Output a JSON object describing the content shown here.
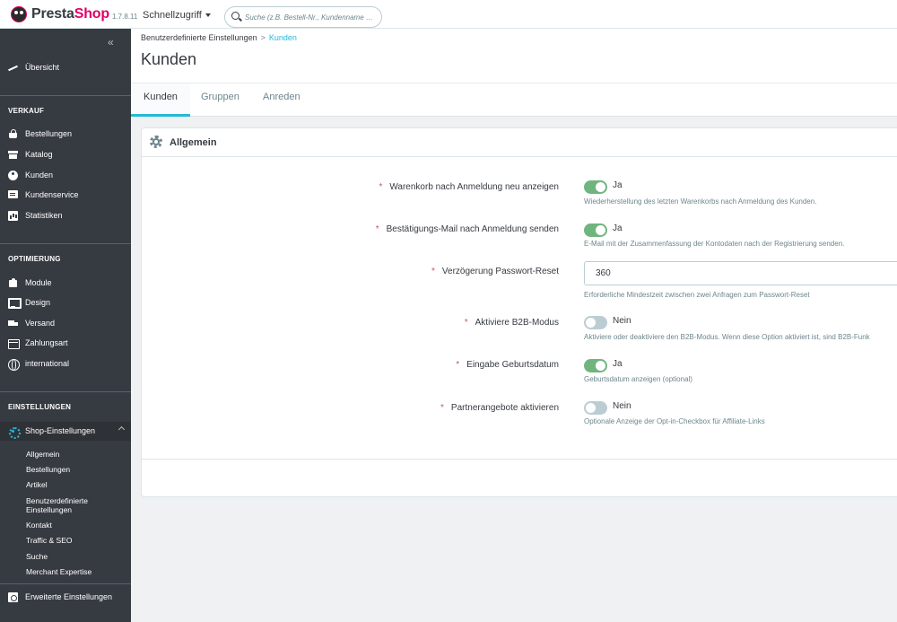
{
  "header": {
    "logo_text_presta": "Presta",
    "logo_text_shop": "Shop",
    "version": "1.7.8.11",
    "quick_access": "Schnellzugriff",
    "search_placeholder": "Suche (z.B. Bestell-Nr., Kundenname …"
  },
  "sidebar": {
    "collapse_icon": "«",
    "overview": "Übersicht",
    "sections": [
      {
        "title": "VERKAUF",
        "items": [
          "Bestellungen",
          "Katalog",
          "Kunden",
          "Kundenservice",
          "Statistiken"
        ]
      },
      {
        "title": "OPTIMIERUNG",
        "items": [
          "Module",
          "Design",
          "Versand",
          "Zahlungsart",
          "international"
        ]
      },
      {
        "title": "EINSTELLUNGEN",
        "items": [
          "Shop-Einstellungen"
        ]
      }
    ],
    "sub_items": [
      "Allgemein",
      "Bestellungen",
      "Artikel",
      "Benutzerdefinierte Einstellungen",
      "Kontakt",
      "Traffic & SEO",
      "Suche",
      "Merchant Expertise"
    ],
    "advanced": "Erweiterte Einstellungen"
  },
  "breadcrumb": {
    "parent": "Benutzerdefinierte Einstellungen",
    "separator": ">",
    "current": "Kunden"
  },
  "page_title": "Kunden",
  "tabs": [
    "Kunden",
    "Gruppen",
    "Anreden"
  ],
  "panel": {
    "title": "Allgemein",
    "rows": [
      {
        "label": "Warenkorb nach Anmeldung neu anzeigen",
        "state": "Ja",
        "on": true,
        "help": "Wiederherstellung des letzten Warenkorbs nach Anmeldung des Kunden."
      },
      {
        "label": "Bestätigungs-Mail nach Anmeldung senden",
        "state": "Ja",
        "on": true,
        "help": "E-Mail mit der Zusammenfassung der Kontodaten nach der Registrierung senden."
      },
      {
        "label": "Verzögerung Passwort-Reset",
        "value": "360",
        "help": "Erforderliche Mindestzeit zwischen zwei Anfragen zum Passwort-Reset"
      },
      {
        "label": "Aktiviere B2B-Modus",
        "state": "Nein",
        "on": false,
        "help": "Aktiviere oder deaktiviere den B2B-Modus. Wenn diese Option aktiviert ist, sind B2B-Funk"
      },
      {
        "label": "Eingabe Geburtsdatum",
        "state": "Ja",
        "on": true,
        "help": "Geburtsdatum anzeigen (optional)"
      },
      {
        "label": "Partnerangebote aktivieren",
        "state": "Nein",
        "on": false,
        "help": "Optionale Anzeige der Opt-in-Checkbox für Affiliate-Links"
      }
    ],
    "required_marker": "*"
  },
  "colors": {
    "accent": "#25b9d7",
    "sidebar": "#363a41",
    "switch_on": "#70b580",
    "brand": "#df0067"
  }
}
